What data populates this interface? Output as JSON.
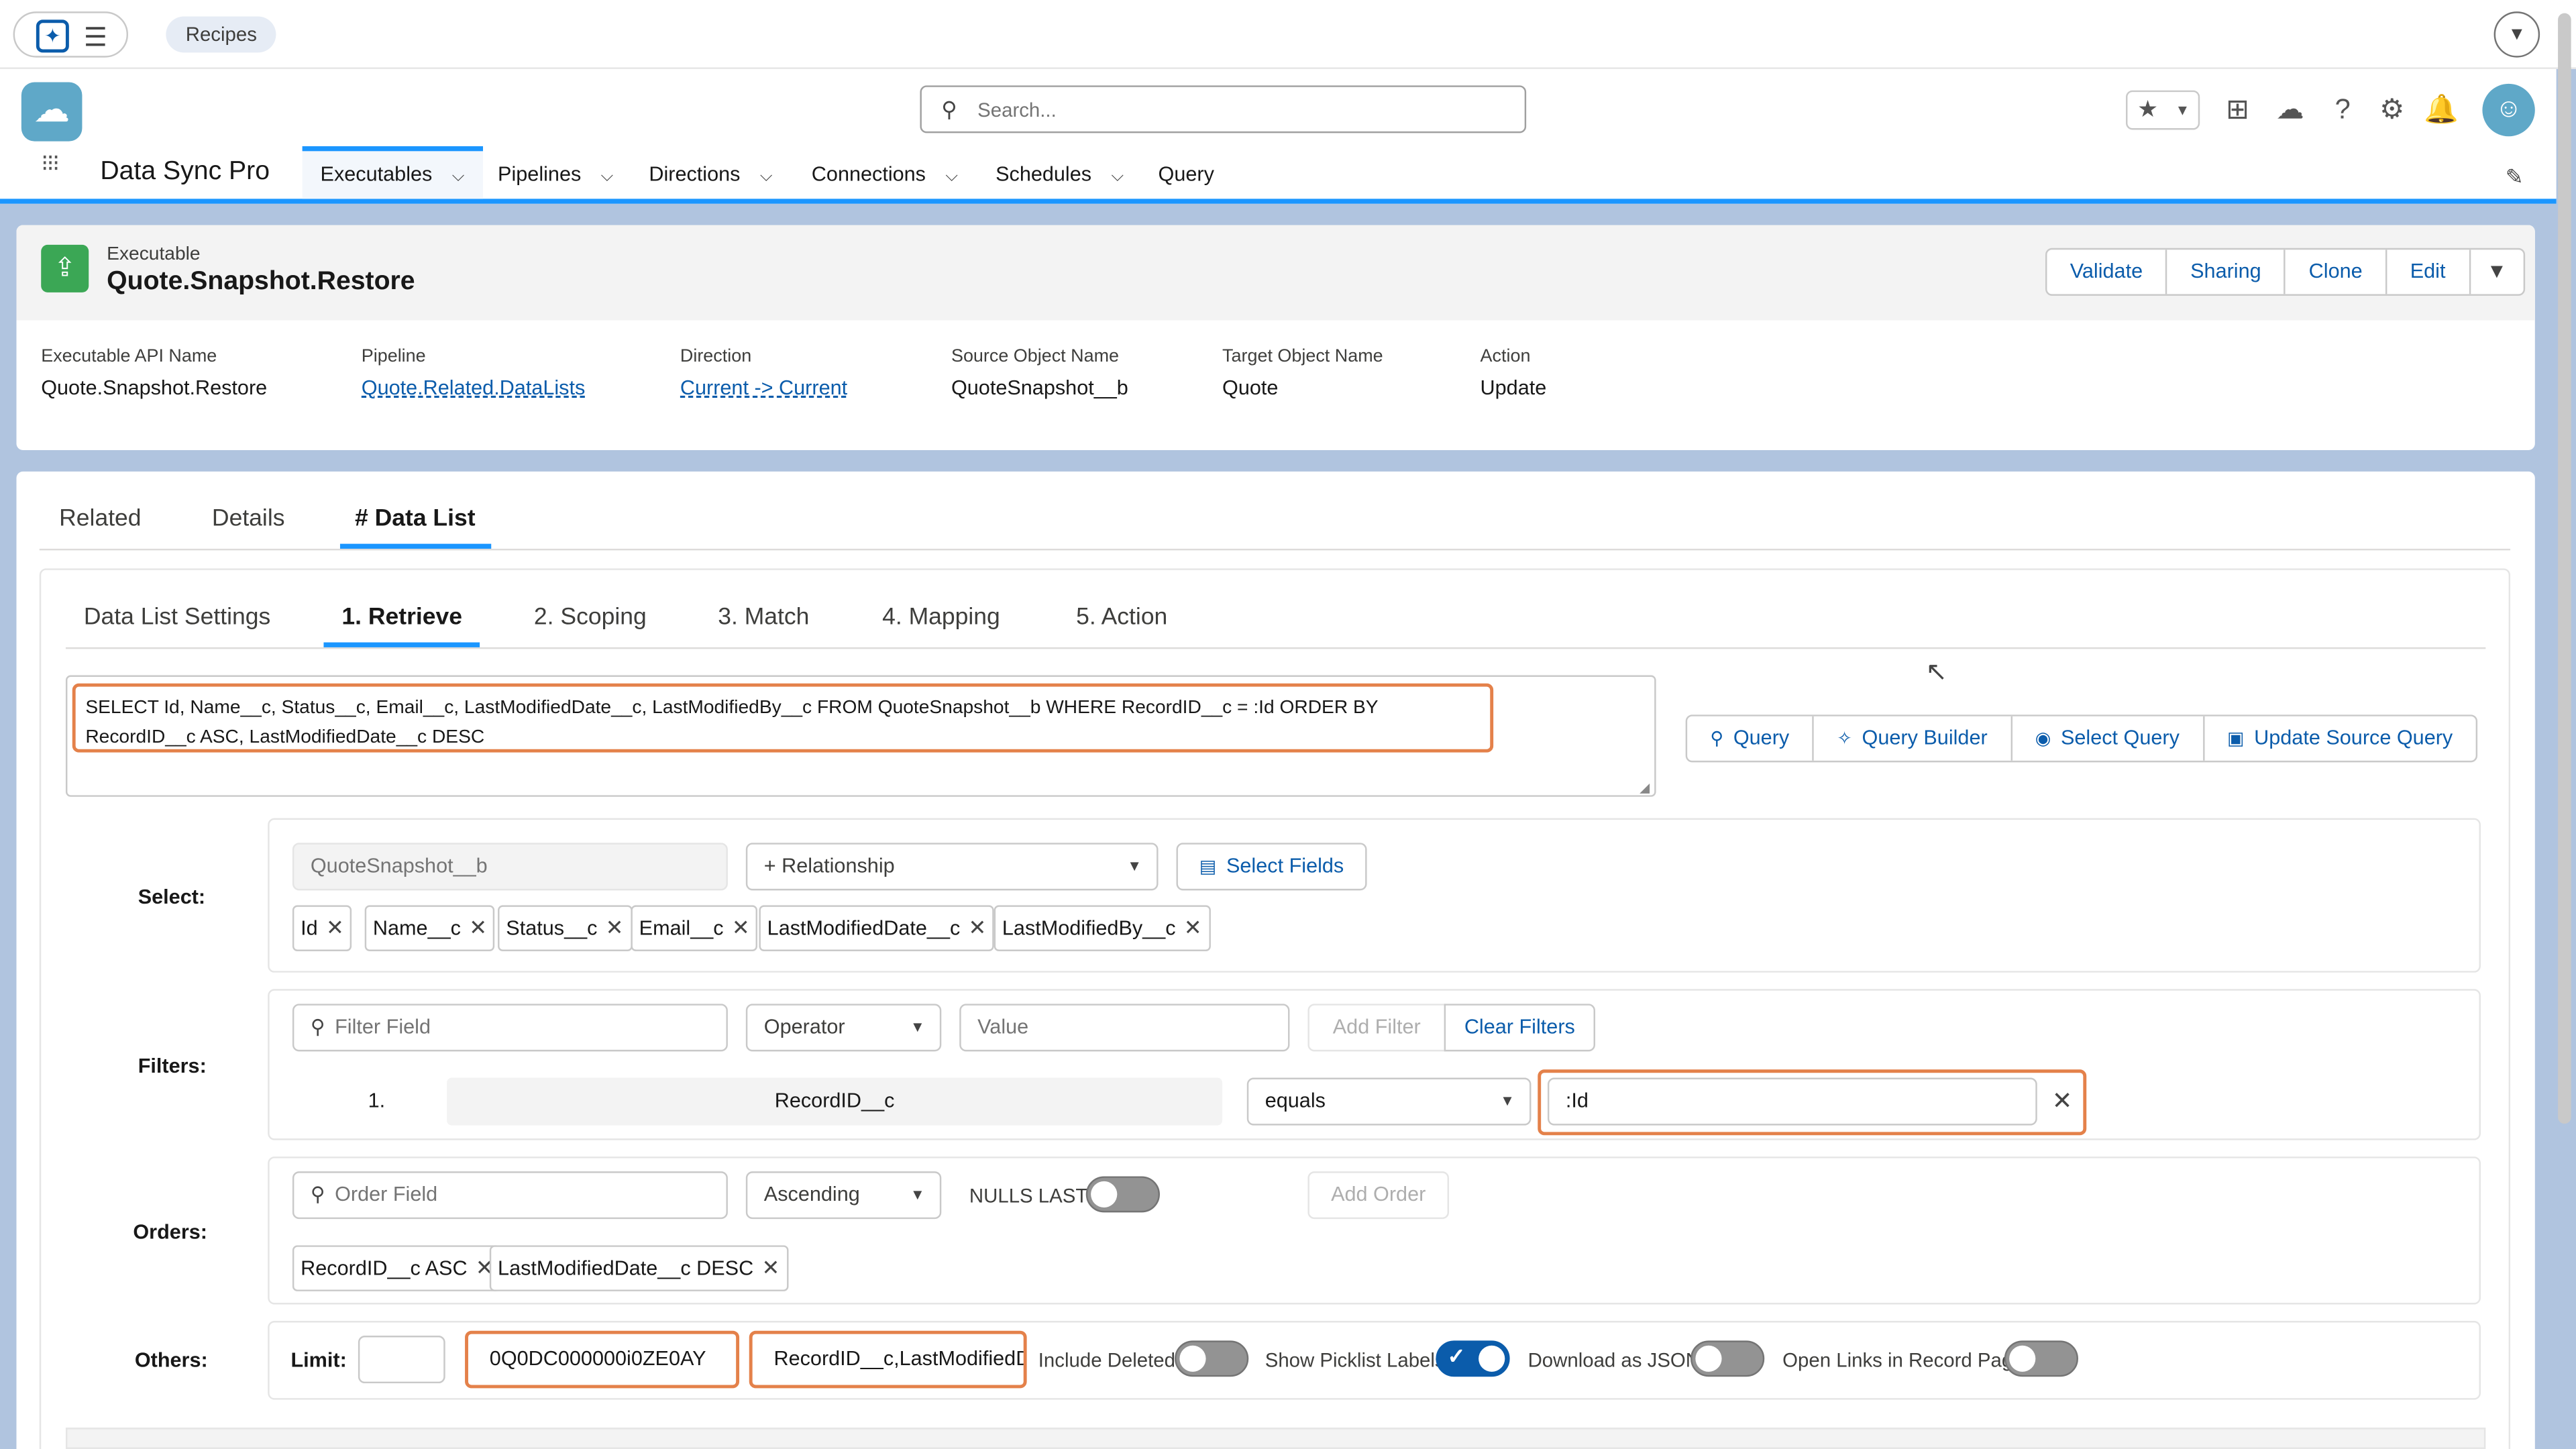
{
  "topbar": {
    "recipes_label": "Recipes"
  },
  "header": {
    "search_placeholder": "Search...",
    "app_name": "Data Sync Pro",
    "nav": [
      {
        "label": "Executables"
      },
      {
        "label": "Pipelines"
      },
      {
        "label": "Directions"
      },
      {
        "label": "Connections"
      },
      {
        "label": "Schedules"
      },
      {
        "label": "Query"
      }
    ]
  },
  "record": {
    "object_type": "Executable",
    "title": "Quote.Snapshot.Restore",
    "actions": [
      "Validate",
      "Sharing",
      "Clone",
      "Edit"
    ],
    "fields": [
      {
        "label": "Executable API Name",
        "value": "Quote.Snapshot.Restore"
      },
      {
        "label": "Pipeline",
        "value": "Quote.Related.DataLists"
      },
      {
        "label": "Direction",
        "value": "Current -> Current"
      },
      {
        "label": "Source Object Name",
        "value": "QuoteSnapshot__b"
      },
      {
        "label": "Target Object Name",
        "value": "Quote"
      },
      {
        "label": "Action",
        "value": "Update"
      }
    ]
  },
  "tabs": [
    "Related",
    "Details",
    "# Data List"
  ],
  "subtabs": [
    "Data List Settings",
    "1. Retrieve",
    "2. Scoping",
    "3. Match",
    "4. Mapping",
    "5. Action"
  ],
  "query": {
    "text": "SELECT Id, Name__c, Status__c, Email__c, LastModifiedDate__c, LastModifiedBy__c FROM QuoteSnapshot__b WHERE RecordID__c = :Id ORDER BY RecordID__c ASC, LastModifiedDate__c DESC",
    "buttons": [
      "Query",
      "Query Builder",
      "Select Query",
      "Update Source Query"
    ]
  },
  "select": {
    "label": "Select:",
    "object": "QuoteSnapshot__b",
    "relationship_placeholder": "+ Relationship",
    "select_fields_label": "Select Fields",
    "fields": [
      "Id",
      "Name__c",
      "Status__c",
      "Email__c",
      "LastModifiedDate__c",
      "LastModifiedBy__c"
    ]
  },
  "filters": {
    "label": "Filters:",
    "field_placeholder": "Filter Field",
    "operator_placeholder": "Operator",
    "value_placeholder": "Value",
    "add_label": "Add Filter",
    "clear_label": "Clear Filters",
    "rows": [
      {
        "index": "1.",
        "field": "RecordID__c",
        "operator": "equals",
        "value": ":Id"
      }
    ]
  },
  "orders": {
    "label": "Orders:",
    "field_placeholder": "Order Field",
    "direction": "Ascending",
    "nulls_last_label": "NULLS LAST?",
    "add_label": "Add Order",
    "items": [
      "RecordID__c ASC",
      "LastModifiedDate__c DESC"
    ]
  },
  "others": {
    "label": "Others:",
    "limit_label": "Limit:",
    "limit_value": "",
    "id_value": "0Q0DC000000i0ZE0AY",
    "order_value": "RecordID__c,LastModifiedDa",
    "toggles": [
      {
        "label": "Include Deleted",
        "on": false
      },
      {
        "label": "Show Picklist Labels",
        "on": true
      },
      {
        "label": "Download as JSON",
        "on": false
      },
      {
        "label": "Open Links in Record Page",
        "on": false
      }
    ]
  },
  "icons": {
    "search": "search-icon",
    "gear": "gear-icon",
    "bell": "bell-icon",
    "help": "help-icon"
  },
  "colors": {
    "accent": "#1b96ff",
    "link": "#0b5cab",
    "highlight": "#e4814a",
    "record_icon": "#3ba755"
  }
}
